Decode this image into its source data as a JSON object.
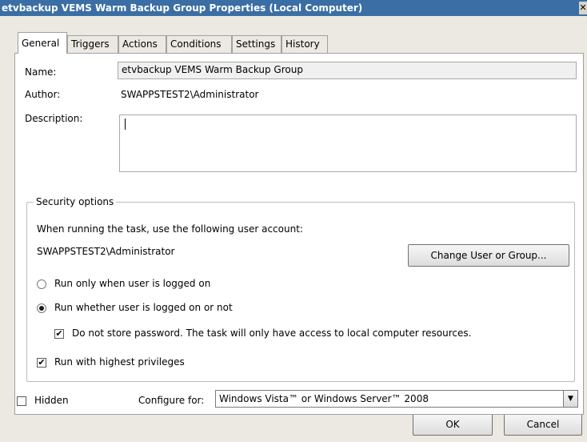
{
  "window": {
    "title": "etvbackup VEMS Warm Backup Group Properties (Local Computer)",
    "close_glyph": "✕"
  },
  "tabs": [
    "General",
    "Triggers",
    "Actions",
    "Conditions",
    "Settings",
    "History"
  ],
  "active_tab": "General",
  "general": {
    "name_label": "Name:",
    "name_value": "etvbackup VEMS Warm Backup Group",
    "author_label": "Author:",
    "author_value": "SWAPPSTEST2\\Administrator",
    "description_label": "Description:",
    "description_value": ""
  },
  "security": {
    "legend": "Security options",
    "account_prompt": "When running the task, use the following user account:",
    "account_value": "SWAPPSTEST2\\Administrator",
    "change_button": "Change User or Group...",
    "radio_logged_on": "Run only when user is logged on",
    "radio_logged_on_selected": false,
    "radio_whether": "Run whether user is logged on or not",
    "radio_whether_selected": true,
    "no_store_password": "Do not store password.  The task will only have access to local computer resources.",
    "no_store_password_checked": true,
    "highest_privileges": "Run with highest privileges",
    "highest_privileges_checked": true
  },
  "footer": {
    "hidden_label": "Hidden",
    "hidden_checked": false,
    "configure_label": "Configure for:",
    "configure_value": "Windows Vista™ or Windows Server™ 2008"
  },
  "buttons": {
    "ok": "OK",
    "cancel": "Cancel"
  },
  "colors": {
    "titlebar": "#3a6ea5",
    "dialog_background": "#ece9e3"
  },
  "icons": {
    "check_glyph": "✔",
    "dropdown_glyph": "▼"
  }
}
